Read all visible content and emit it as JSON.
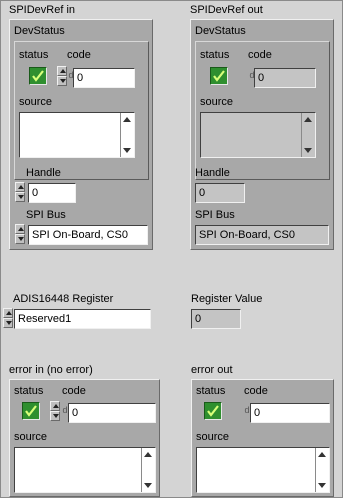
{
  "spidevref_in": {
    "label": "SPIDevRef in",
    "devstatus": {
      "label": "DevStatus",
      "status_label": "status",
      "code_label": "code",
      "code_value": "0",
      "source_label": "source"
    },
    "handle_label": "Handle",
    "handle_value": "0",
    "spi_bus_label": "SPI Bus",
    "spi_bus_value": "SPI On-Board, CS0"
  },
  "spidevref_out": {
    "label": "SPIDevRef out",
    "devstatus": {
      "label": "DevStatus",
      "status_label": "status",
      "code_label": "code",
      "code_value": "0",
      "source_label": "source"
    },
    "handle_label": "Handle",
    "handle_value": "0",
    "spi_bus_label": "SPI Bus",
    "spi_bus_value": "SPI On-Board, CS0"
  },
  "register": {
    "label": "ADIS16448 Register",
    "value": "Reserved1",
    "register_value_label": "Register Value",
    "register_value": "0"
  },
  "error_in": {
    "label": "error in (no error)",
    "status_label": "status",
    "code_label": "code",
    "code_value": "0",
    "source_label": "source"
  },
  "error_out": {
    "label": "error out",
    "status_label": "status",
    "code_label": "code",
    "code_value": "0",
    "source_label": "source"
  },
  "radix_glyph": "d",
  "colors": {
    "background": "#d4d4d4",
    "cluster": "#a8a8a8",
    "led_on": "#2f8f2f"
  },
  "icons": [
    "checkmark-icon",
    "spinner-up-icon",
    "spinner-down-icon",
    "scroll-up-icon",
    "scroll-down-icon"
  ]
}
